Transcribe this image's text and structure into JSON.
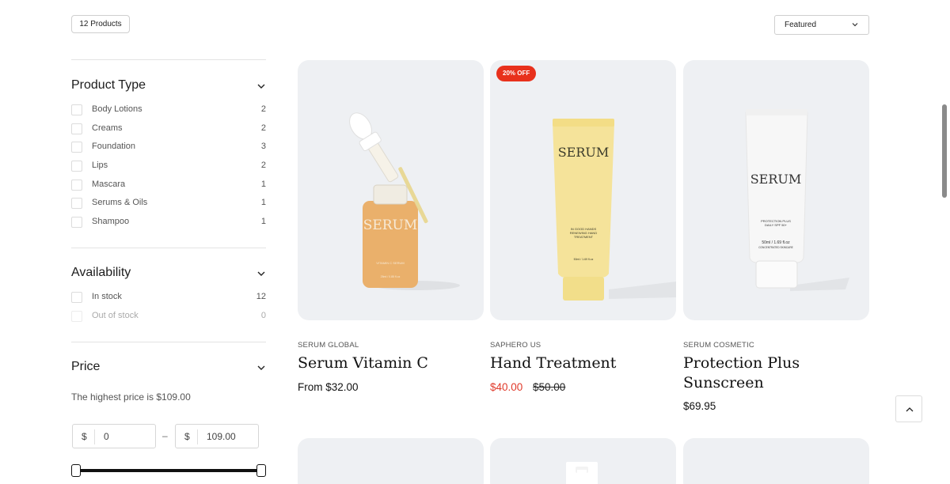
{
  "toolbar": {
    "product_count": "12 Products",
    "sort_value": "Featured"
  },
  "filters": {
    "product_type": {
      "title": "Product Type",
      "options": [
        {
          "label": "Body Lotions",
          "count": "2"
        },
        {
          "label": "Creams",
          "count": "2"
        },
        {
          "label": "Foundation",
          "count": "3"
        },
        {
          "label": "Lips",
          "count": "2"
        },
        {
          "label": "Mascara",
          "count": "1"
        },
        {
          "label": "Serums & Oils",
          "count": "1"
        },
        {
          "label": "Shampoo",
          "count": "1"
        }
      ]
    },
    "availability": {
      "title": "Availability",
      "options": [
        {
          "label": "In stock",
          "count": "12"
        },
        {
          "label": "Out of stock",
          "count": "0"
        }
      ]
    },
    "price": {
      "title": "Price",
      "note": "The highest price is $109.00",
      "currency": "$",
      "min_value": "0",
      "max_value": "109.00",
      "dash": "–"
    }
  },
  "products": [
    {
      "vendor": "SERUM GLOBAL",
      "title": "Serum Vitamin C",
      "price": "From $32.00"
    },
    {
      "vendor": "SAPHERO US",
      "title": "Hand Treatment",
      "price": "$40.00",
      "compare_price": "$50.00",
      "badge": "20% OFF"
    },
    {
      "vendor": "SERUM COSMETIC",
      "title": "Protection Plus Sunscreen",
      "price": "$69.95"
    }
  ],
  "product_art": {
    "brand": "SERUM",
    "bottle_label": "VITAMIN C SERUM",
    "bottle_size": "25ml / 0.85 fl.oz",
    "tube1_label1": "IN GOOD HANDS",
    "tube1_label2": "RENEWING HAND",
    "tube1_label3": "TREATMENT",
    "tube1_size": "50ml / 1.69 fl.oz",
    "tube2_label1": "PROTECTION PLUS",
    "tube2_label2": "DAILY SPF 50+",
    "tube2_size": "50ml / 1.69 fl.oz",
    "tube2_label3": "CONCENTRATED SKINCARE"
  },
  "colors": {
    "sale": "#e03a2b",
    "badge": "#e8311c",
    "card_bg": "#eef0f3"
  }
}
